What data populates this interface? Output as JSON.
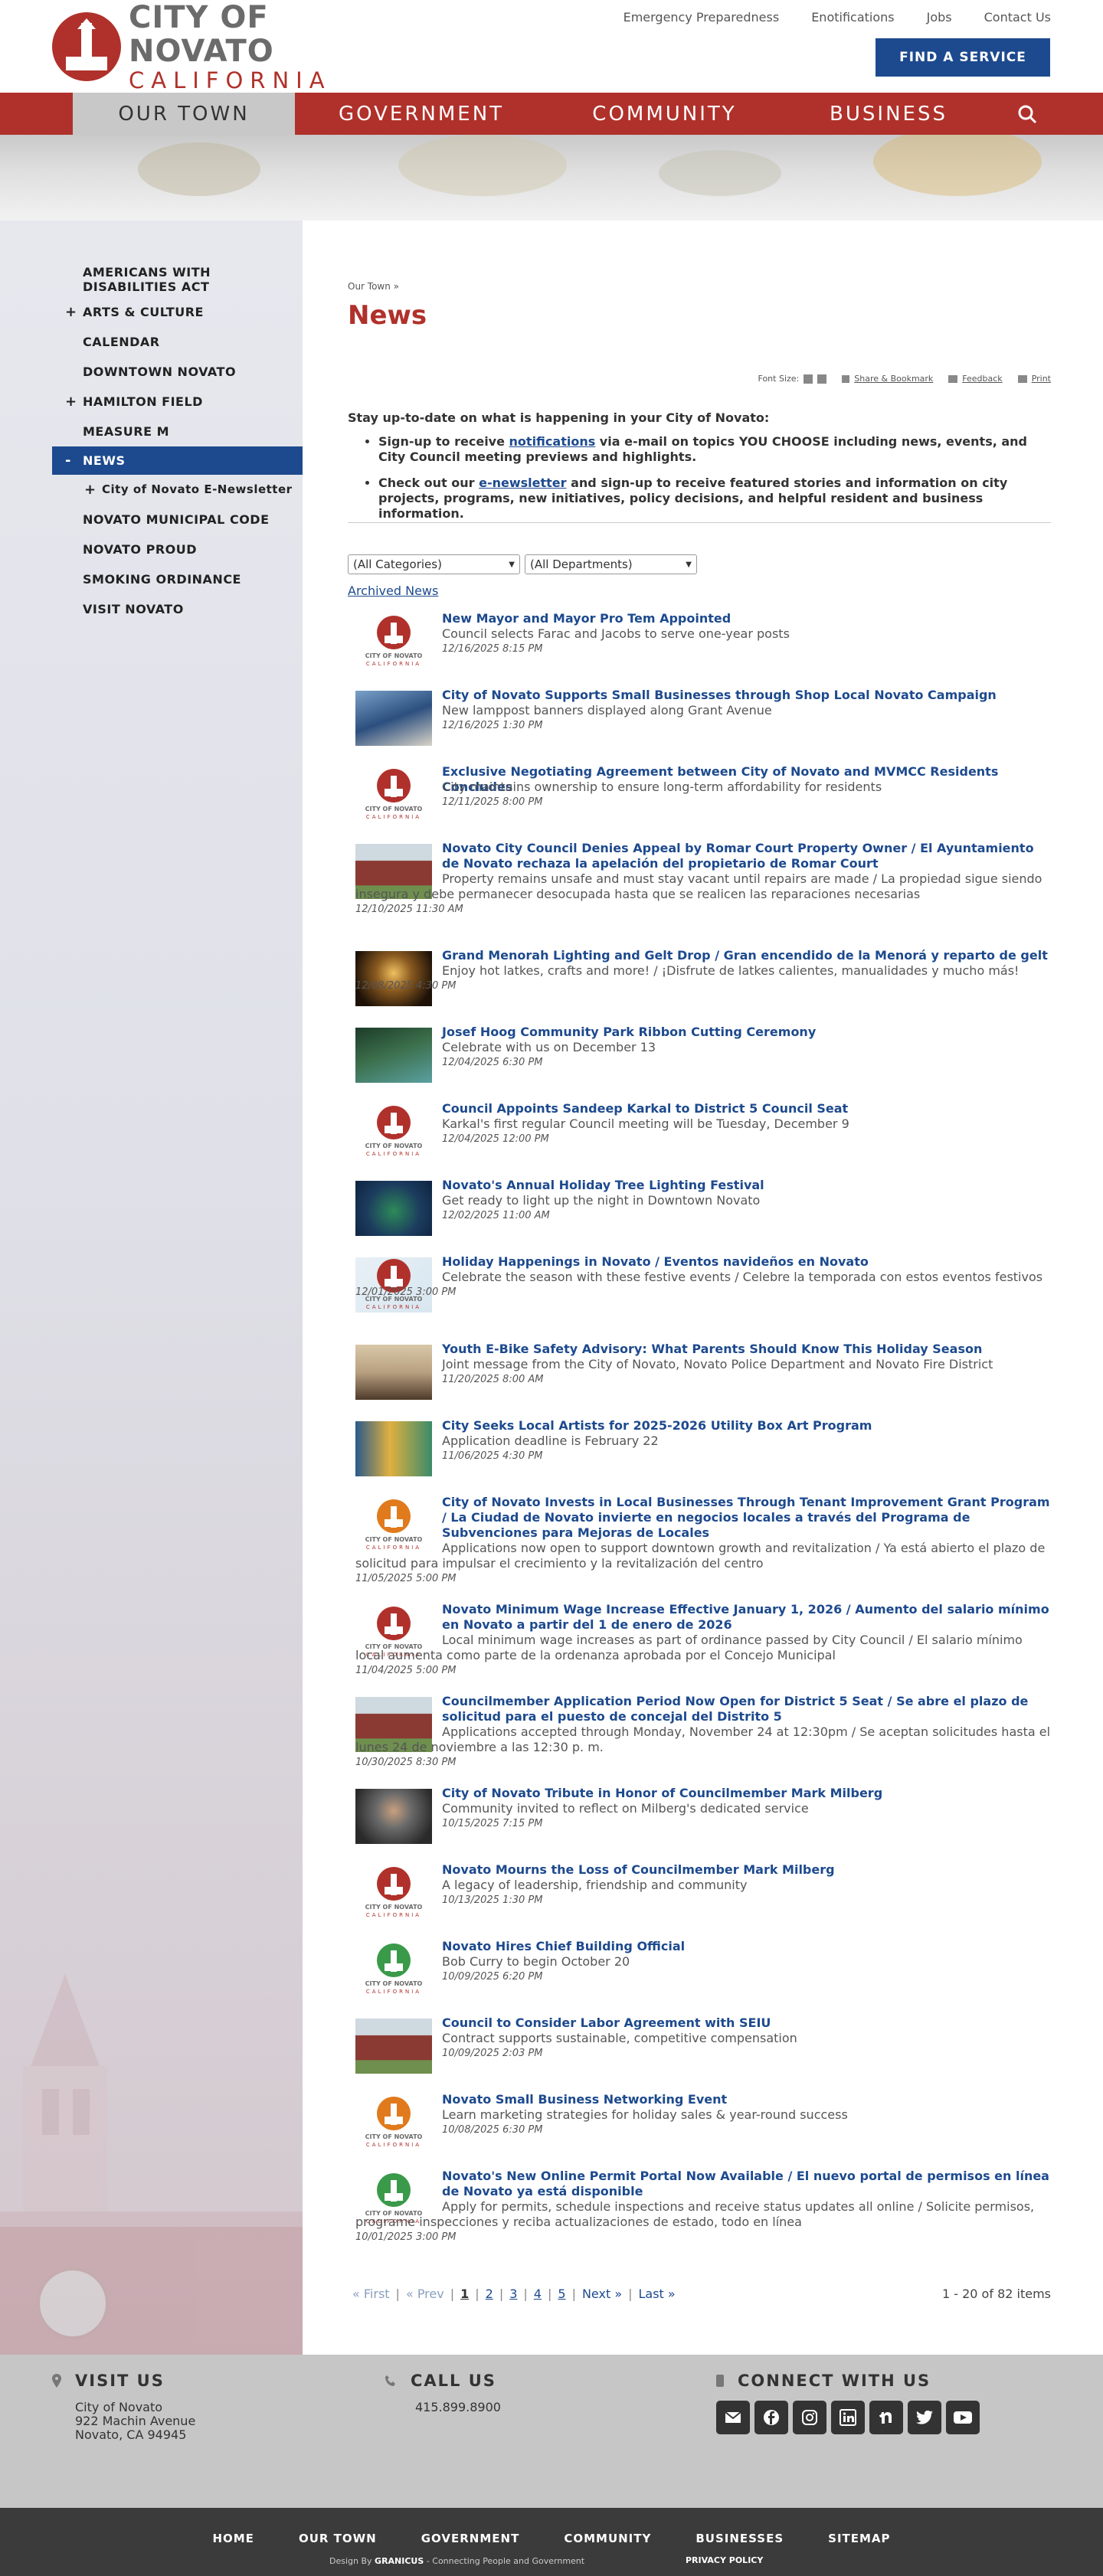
{
  "header": {
    "logo_city": "CITY OF NOVATO",
    "logo_state": "CALIFORNIA",
    "util_links": [
      "Emergency Preparedness",
      "Enotifications",
      "Jobs",
      "Contact Us"
    ],
    "find_service": "FIND A SERVICE"
  },
  "nav": {
    "items": [
      "OUR TOWN",
      "GOVERNMENT",
      "COMMUNITY",
      "BUSINESS"
    ],
    "active": "OUR TOWN",
    "search_icon": "search-icon"
  },
  "sidebar": {
    "items": [
      {
        "label": "AMERICANS WITH DISABILITIES ACT",
        "plus": ""
      },
      {
        "label": "ARTS & CULTURE",
        "plus": "+"
      },
      {
        "label": "CALENDAR",
        "plus": ""
      },
      {
        "label": "DOWNTOWN NOVATO",
        "plus": ""
      },
      {
        "label": "HAMILTON FIELD",
        "plus": "+"
      },
      {
        "label": "MEASURE M",
        "plus": ""
      },
      {
        "label": "NEWS",
        "plus": "-"
      },
      {
        "label": "City of Novato E-Newsletter",
        "plus": "+"
      },
      {
        "label": "NOVATO MUNICIPAL CODE",
        "plus": ""
      },
      {
        "label": "NOVATO PROUD",
        "plus": ""
      },
      {
        "label": "SMOKING ORDINANCE",
        "plus": ""
      },
      {
        "label": "VISIT NOVATO",
        "plus": ""
      }
    ]
  },
  "main": {
    "breadcrumb": "Our Town »",
    "title": "News",
    "tools": {
      "font_size": "Font Size:",
      "share": "Share & Bookmark",
      "feedback": "Feedback",
      "print": "Print"
    },
    "intro": {
      "lead": "Stay up-to-date on what is happening in your City of Novato:",
      "b1_pre": "Sign-up to receive ",
      "b1_link": "notifications",
      "b1_post": " via e-mail on topics YOU CHOOSE including news, events, and City Council meeting previews and highlights.",
      "b2_pre": "Check out our ",
      "b2_link": "e-newsletter",
      "b2_post": " and sign-up to receive featured stories and information on city projects, programs, new initiatives, policy decisions, and helpful resident and business information."
    },
    "filters": {
      "categories": "(All Categories)",
      "departments": "(All Departments)"
    },
    "archived": "Archived News"
  },
  "news": [
    {
      "title": "New Mayor and Mayor Pro Tem Appointed",
      "desc": "Council selects Farac and Jacobs to serve one-year posts",
      "date": "12/16/2025 8:15 PM",
      "thumb": "seal-red"
    },
    {
      "title": "City of Novato Supports Small Businesses through Shop Local Novato Campaign",
      "desc": "New lamppost banners displayed along Grant Avenue",
      "date": "12/16/2025 1:30 PM",
      "thumb": "banner-photo"
    },
    {
      "title": "Exclusive Negotiating Agreement between City of Novato and MVMCC Residents Concludes",
      "desc": "City maintains ownership to ensure long-term affordability for residents",
      "date": "12/11/2025 8:00 PM",
      "thumb": "seal-red"
    },
    {
      "title": "Novato City Council Denies Appeal by Romar Court Property Owner / El Ayuntamiento de Novato rechaza la apelación del propietario de Romar Court",
      "desc": "Property remains unsafe and must stay vacant until repairs are made / La propiedad sigue siendo insegura y debe permanecer desocupada hasta que se realicen las reparaciones necesarias",
      "date": "12/10/2025 11:30 AM",
      "thumb": "city-hall-photo"
    },
    {
      "title": "Grand Menorah Lighting and Gelt Drop / Gran encendido de la Menorá y reparto de gelt",
      "desc": "Enjoy hot latkes, crafts and more! / ¡Disfrute de latkes calientes, manualidades y mucho más!",
      "date": "12/08/2025 4:30 PM",
      "thumb": "menorah-photo"
    },
    {
      "title": "Josef Hoog Community Park Ribbon Cutting Ceremony",
      "desc": "Celebrate with us on December 13",
      "date": "12/04/2025 6:30 PM",
      "thumb": "park-photo"
    },
    {
      "title": "Council Appoints Sandeep Karkal to District 5 Council Seat",
      "desc": "Karkal's first regular Council meeting will be Tuesday, December 9",
      "date": "12/04/2025 12:00 PM",
      "thumb": "seal-red"
    },
    {
      "title": "Novato's Annual Holiday Tree Lighting Festival",
      "desc": "Get ready to light up the night in Downtown Novato",
      "date": "12/02/2025 11:00 AM",
      "thumb": "tree-photo"
    },
    {
      "title": "Holiday Happenings in Novato / Eventos navideños en Novato",
      "desc": "Celebrate the season with these festive events / Celebre la temporada con estos eventos festivos",
      "date": "12/01/2025 3:00 PM",
      "thumb": "seal-holiday"
    },
    {
      "title": "Youth E-Bike Safety Advisory: What Parents Should Know This Holiday Season",
      "desc": "Joint message from the City of Novato, Novato Police Department and Novato Fire District",
      "date": "11/20/2025 8:00 AM",
      "thumb": "bike-photo"
    },
    {
      "title": "City Seeks Local Artists for 2025-2026 Utility Box Art Program",
      "desc": "Application deadline is February 22",
      "date": "11/06/2025 4:30 PM",
      "thumb": "art-photo"
    },
    {
      "title": "City of Novato Invests in Local Businesses Through Tenant Improvement Grant Program / La Ciudad de Novato invierte en negocios locales a través del Programa de Subvenciones para Mejoras de Locales",
      "desc": "Applications now open to support downtown growth and revitalization / Ya está abierto el plazo de solicitud para impulsar el crecimiento y la revitalización del centro",
      "date": "11/05/2025 5:00 PM",
      "thumb": "seal-orange"
    },
    {
      "title": "Novato Minimum Wage Increase Effective January 1, 2026 / Aumento del salario mínimo en Novato a partir del 1 de enero de 2026",
      "desc": "Local minimum wage increases as part of ordinance passed by City Council / El salario mínimo local aumenta como parte de la ordenanza aprobada por el Concejo Municipal",
      "date": "11/04/2025 5:00 PM",
      "thumb": "seal-red"
    },
    {
      "title": "Councilmember Application Period Now Open for District 5 Seat / Se abre el plazo de solicitud para el puesto de concejal del Distrito 5",
      "desc": "Applications accepted through Monday, November 24 at 12:30pm / Se aceptan solicitudes hasta el lunes 24 de noviembre a las 12:30 p. m.",
      "date": "10/30/2025 8:30 PM",
      "thumb": "city-hall-photo"
    },
    {
      "title": "City of Novato Tribute in Honor of Councilmember Mark Milberg",
      "desc": "Community invited to reflect on Milberg's dedicated service",
      "date": "10/15/2025 7:15 PM",
      "thumb": "portrait-photo"
    },
    {
      "title": "Novato Mourns the Loss of Councilmember Mark Milberg",
      "desc": "A legacy of leadership, friendship and community",
      "date": "10/13/2025 1:30 PM",
      "thumb": "seal-red"
    },
    {
      "title": "Novato Hires Chief Building Official",
      "desc": "Bob Curry to begin October 20",
      "date": "10/09/2025 6:20 PM",
      "thumb": "seal-green"
    },
    {
      "title": "Council to Consider Labor Agreement with SEIU",
      "desc": "Contract supports sustainable, competitive compensation",
      "date": "10/09/2025 2:03 PM",
      "thumb": "city-hall-photo"
    },
    {
      "title": "Novato Small Business Networking Event",
      "desc": "Learn marketing strategies for holiday sales & year-round success",
      "date": "10/08/2025 6:30 PM",
      "thumb": "seal-orange"
    },
    {
      "title": "Novato's New Online Permit Portal Now Available / El nuevo portal de permisos en línea de Novato ya está disponible",
      "desc": "Apply for permits, schedule inspections and receive status updates all online / Solicite permisos, programe inspecciones y reciba actualizaciones de estado, todo en línea",
      "date": "10/01/2025 3:00 PM",
      "thumb": "seal-green"
    }
  ],
  "pager": {
    "first": "« First",
    "prev": "« Prev",
    "pages": [
      "1",
      "2",
      "3",
      "4",
      "5"
    ],
    "current": "1",
    "next": "Next »",
    "last": "Last »",
    "count": "1 - 20 of 82 items"
  },
  "footer": {
    "visit_head": "VISIT US",
    "visit_lines": [
      "City of Novato",
      "922 Machin Avenue",
      "Novato, CA 94945"
    ],
    "call_head": "CALL US",
    "phone": "415.899.8900",
    "connect_head": "CONNECT WITH US",
    "social": [
      "email-icon",
      "facebook-icon",
      "instagram-icon",
      "linkedin-icon",
      "nextdoor-icon",
      "twitter-icon",
      "youtube-icon"
    ]
  },
  "bottom": {
    "links": [
      "HOME",
      "OUR TOWN",
      "GOVERNMENT",
      "COMMUNITY",
      "BUSINESSES",
      "SITEMAP"
    ],
    "design_by": "Design By",
    "granicus": "GRANICUS",
    "tagline": "- Connecting People and Government",
    "privacy": "PRIVACY POLICY"
  },
  "colors": {
    "brand_red": "#b0312b",
    "brand_blue": "#1d4a8e"
  }
}
